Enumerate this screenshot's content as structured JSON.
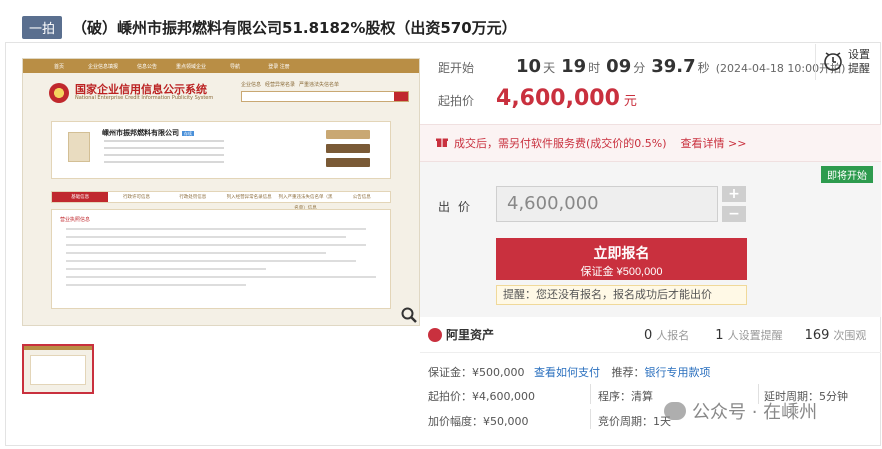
{
  "header": {
    "badge": "一拍",
    "title": "（破）嵊州市振邦燃料有限公司51.8182%股权（出资570万元）"
  },
  "preview": {
    "topnav": [
      "首页",
      "企业信息填报",
      "信息公告",
      "重点领域企业",
      "导航",
      "登录 注册"
    ],
    "site_name": "国家企业信用信息公示系统",
    "site_name_en": "National Enterprise Credit Information Publicity System",
    "search_tabs": [
      "企业信息",
      "经营异常名录",
      "严重违法失信名单"
    ],
    "company_name": "嵊州市振邦燃料有限公司",
    "company_tag": "存续",
    "tabs": [
      "基础信息",
      "行政许可信息",
      "行政处罚信息",
      "列入经营异常名录信息",
      "列入严重违法失信名单（黑名单）信息",
      "公告信息"
    ],
    "section_title": "营业执照信息",
    "zoom_icon": "magnifier-icon"
  },
  "countdown": {
    "label": "距开始",
    "days": "10",
    "days_unit": "天",
    "hours": "19",
    "hours_unit": "时",
    "minutes": "09",
    "minutes_unit": "分",
    "seconds": "39.7",
    "seconds_unit": "秒",
    "start_time": "(2024-04-18 10:00开拍)"
  },
  "settings": {
    "line1": "设置",
    "line2": "提醒",
    "icon": "alarm-clock-icon"
  },
  "start_price": {
    "label": "起拍价",
    "value": "4,600,000",
    "unit": "元"
  },
  "fee_notice": {
    "text": "成交后，需另付软件服务费(成交价的0.5%)",
    "link": "查看详情 >>",
    "icon": "gift-icon"
  },
  "bid": {
    "status": "即将开始",
    "label": "出价",
    "value": "4,600,000",
    "plus": "+",
    "minus": "−",
    "button_label": "立即报名",
    "button_sub": "保证金 ¥500,000",
    "tip": "提醒：您还没有报名，报名成功后才能出价"
  },
  "stats": {
    "platform": "阿里资产",
    "signups_n": "0",
    "signups_t": "人报名",
    "reminders_n": "1",
    "reminders_t": "人设置提醒",
    "views_n": "169",
    "views_t": "次围观"
  },
  "info": {
    "deposit": "保证金：¥500,000",
    "deposit_link": "查看如何支付",
    "recommend_label": "推荐：",
    "recommend_link": "银行专用款项",
    "start_price": "起拍价：¥4,600,000",
    "procedure": "程序：清算",
    "delay": "延时周期：5分钟",
    "increment": "加价幅度：¥50,000",
    "cycle": "竞价周期：1天"
  },
  "watermark": "公众号 · 在嵊州"
}
